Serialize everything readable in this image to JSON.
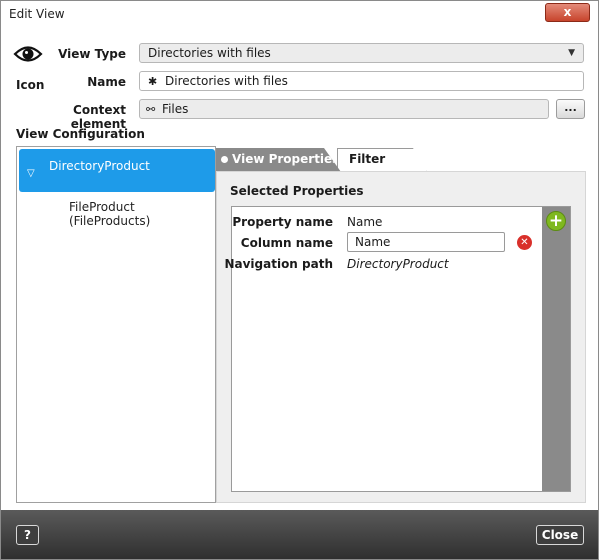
{
  "window": {
    "title": "Edit View",
    "close_glyph": "x"
  },
  "form": {
    "icon_label": "Icon",
    "icon_name": "eye-icon",
    "view_type_label": "View Type",
    "view_type_value": "Directories with files",
    "name_label": "Name",
    "name_value": "Directories with files",
    "name_prefix_icon": "asterisk-icon",
    "context_label": "Context element",
    "context_value": "Files",
    "context_icon": "link-icon",
    "browse_label": "..."
  },
  "view_config": {
    "title": "View Configuration",
    "tree": {
      "selected_label": "DirectoryProduct",
      "children": [
        "FileProduct",
        "(FileProducts)"
      ]
    }
  },
  "tabs": {
    "active_label": "View Properties",
    "inactive_label": "Filter"
  },
  "selected_properties": {
    "title": "Selected Properties",
    "property_name_label": "Property name",
    "property_name_value": "Name",
    "column_name_label": "Column name",
    "column_name_value": "Name",
    "navigation_path_label": "Navigation path",
    "navigation_path_value": "DirectoryProduct",
    "add_icon": "add-icon",
    "remove_icon": "remove-icon"
  },
  "footer": {
    "help_label": "?",
    "close_label": "Close"
  },
  "colors": {
    "accent_blue": "#1e9be9",
    "add_green": "#7fb81f",
    "remove_red": "#d9302b",
    "footer_dark": "#2f2f2f"
  }
}
